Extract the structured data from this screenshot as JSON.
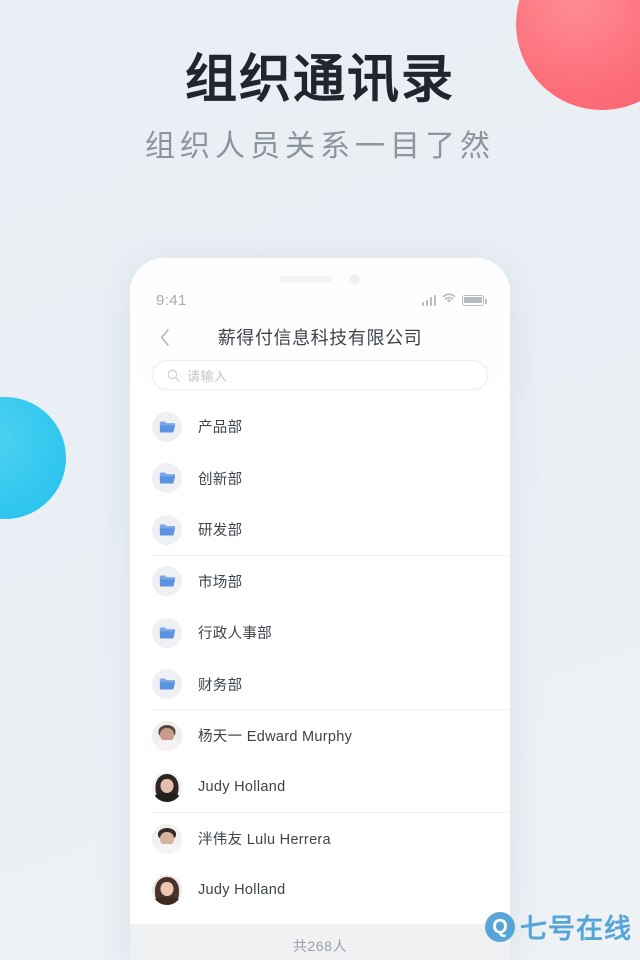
{
  "page": {
    "headline": "组织通讯录",
    "subhead": "组织人员关系一目了然"
  },
  "decor": {
    "pink_circle_color": "#fc6d78",
    "blue_circle_color": "#35c8ef",
    "background_color": "#eaeff5"
  },
  "phone": {
    "status_bar": {
      "time": "9:41",
      "signal_icon": "signal-bars-icon",
      "wifi_icon": "wifi-icon",
      "battery_icon": "battery-icon"
    },
    "navbar": {
      "back_icon": "chevron-left-icon",
      "title": "薪得付信息科技有限公司"
    },
    "search": {
      "icon": "search-icon",
      "placeholder": "请输入",
      "value": ""
    },
    "list": [
      {
        "type": "folder",
        "icon": "folder-icon",
        "label": "产品部",
        "divider": false
      },
      {
        "type": "folder",
        "icon": "folder-icon",
        "label": "创新部",
        "divider": false
      },
      {
        "type": "folder",
        "icon": "folder-icon",
        "label": "研发部",
        "divider": true
      },
      {
        "type": "folder",
        "icon": "folder-icon",
        "label": "市场部",
        "divider": false
      },
      {
        "type": "folder",
        "icon": "folder-icon",
        "label": "行政人事部",
        "divider": false
      },
      {
        "type": "folder",
        "icon": "folder-icon",
        "label": "财务部",
        "divider": true
      },
      {
        "type": "person",
        "avatar": "avatar-male-photo",
        "label": "杨天一  Edward Murphy",
        "divider": false
      },
      {
        "type": "person",
        "avatar": "avatar-female-photo",
        "label": "Judy Holland",
        "divider": true
      },
      {
        "type": "person",
        "avatar": "avatar-male-photo",
        "label": "泮伟友  Lulu Herrera",
        "divider": false
      },
      {
        "type": "person",
        "avatar": "avatar-female-photo",
        "label": "Judy Holland",
        "divider": false
      }
    ],
    "footer": {
      "total_text": "共268人"
    }
  },
  "watermark": {
    "logo_letter": "Q",
    "text": "七号在线",
    "color": "#4a9fd4"
  }
}
